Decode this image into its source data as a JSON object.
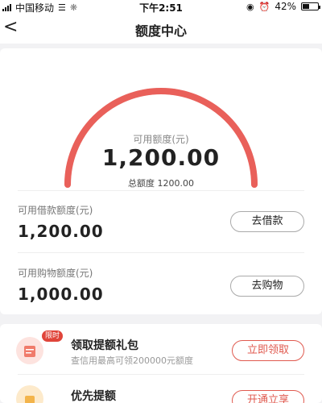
{
  "status": {
    "carrier": "中国移动",
    "time": "下午2:51",
    "battery": "42%",
    "battery_level": 0.42
  },
  "nav": {
    "back": "<",
    "title": "额度中心"
  },
  "gauge": {
    "label": "可用额度(元)",
    "value": "1,200.00",
    "total": "总额度 1200.00",
    "fill_ratio": 1.0,
    "color": "#e9605a"
  },
  "loan": {
    "label": "可用借款额度(元)",
    "value": "1,200.00",
    "button": "去借款"
  },
  "shop": {
    "label": "可用购物额度(元)",
    "value": "1,000.00",
    "button": "去购物"
  },
  "promos": [
    {
      "tag": "限时",
      "title": "领取提额礼包",
      "sub": "查信用最高可领200000元额度",
      "button": "立即领取",
      "icon": "gift-box-icon"
    },
    {
      "title": "优先提额",
      "button": "开通立享",
      "icon": "priority-icon"
    }
  ],
  "colors": {
    "accent": "#e05a4f",
    "background": "#f2f2f4"
  }
}
